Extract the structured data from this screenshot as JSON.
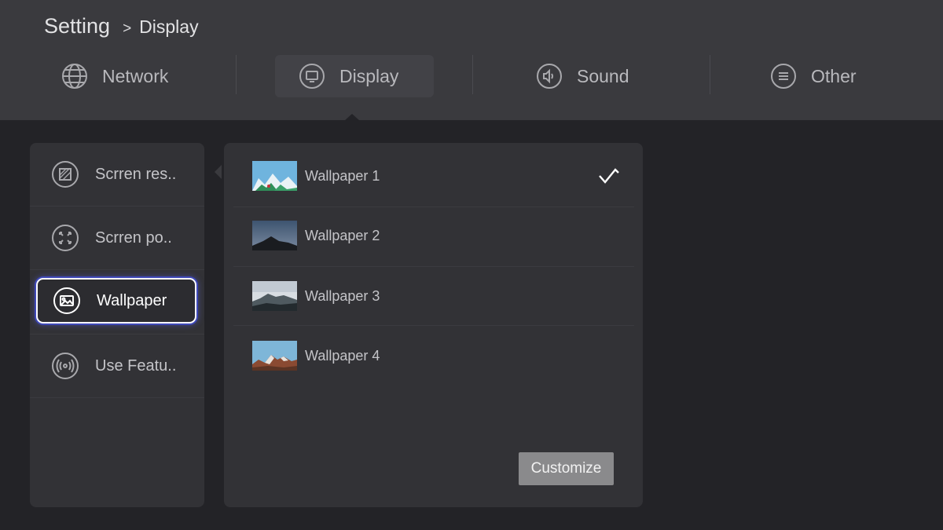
{
  "breadcrumb": {
    "root": "Setting",
    "separator": ">",
    "current": "Display"
  },
  "tabs": [
    {
      "label": "Network",
      "icon": "globe-icon",
      "selected": false
    },
    {
      "label": "Display",
      "icon": "monitor-icon",
      "selected": true
    },
    {
      "label": "Sound",
      "icon": "speaker-icon",
      "selected": false
    },
    {
      "label": "Other",
      "icon": "list-icon",
      "selected": false
    }
  ],
  "side_menu": {
    "items": [
      {
        "label": "Scrren res..",
        "icon": "screen-resolution-icon",
        "focused": false
      },
      {
        "label": "Scrren po..",
        "icon": "expand-arrows-icon",
        "focused": false
      },
      {
        "label": "Wallpaper",
        "icon": "image-icon",
        "focused": true
      },
      {
        "label": "Use Featu..",
        "icon": "broadcast-icon",
        "focused": false
      }
    ]
  },
  "wallpapers": {
    "items": [
      {
        "label": "Wallpaper 1",
        "selected": true
      },
      {
        "label": "Wallpaper 2",
        "selected": false
      },
      {
        "label": "Wallpaper 3",
        "selected": false
      },
      {
        "label": "Wallpaper 4",
        "selected": false
      }
    ],
    "customize_label": "Customize"
  },
  "colors": {
    "background": "#232327",
    "header": "#3a3a3e",
    "panel": "#323236",
    "focus_ring": "#3e48b8",
    "button": "#8a8a8c"
  }
}
